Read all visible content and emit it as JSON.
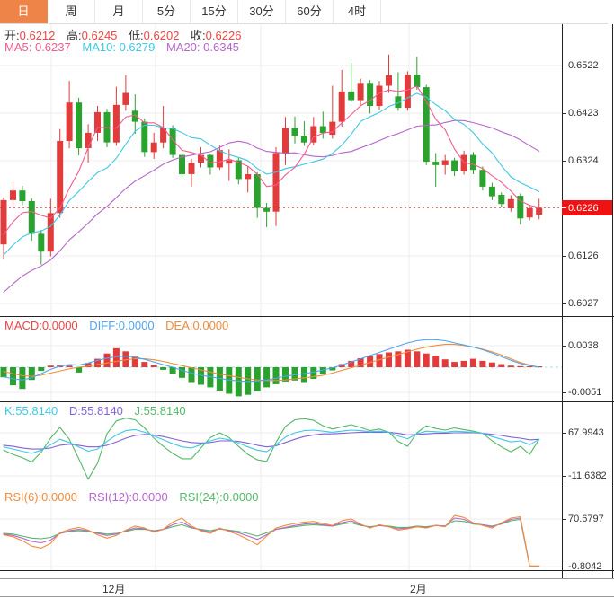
{
  "tabs": {
    "items": [
      {
        "label": "日",
        "active": true
      },
      {
        "label": "周",
        "active": false
      },
      {
        "label": "月",
        "active": false
      },
      {
        "label": "5分",
        "active": false
      },
      {
        "label": "15分",
        "active": false
      },
      {
        "label": "30分",
        "active": false
      },
      {
        "label": "60分",
        "active": false
      },
      {
        "label": "4时",
        "active": false
      }
    ]
  },
  "main_header": {
    "ohlc": [
      {
        "label": "开:",
        "value": "0.6212"
      },
      {
        "label": "高:",
        "value": "0.6245"
      },
      {
        "label": "低:",
        "value": "0.6202"
      },
      {
        "label": "收:",
        "value": "0.6226"
      }
    ],
    "ma": [
      {
        "label": "MA5:",
        "value": "0.6237"
      },
      {
        "label": "MA10:",
        "value": "0.6279"
      },
      {
        "label": "MA20:",
        "value": "0.6345"
      }
    ]
  },
  "macd_header": [
    {
      "label": "MACD:",
      "value": "0.0000"
    },
    {
      "label": "DIFF:",
      "value": "0.0000"
    },
    {
      "label": "DEA:",
      "value": "0.0000"
    }
  ],
  "kdj_header": [
    {
      "label": "K:",
      "value": "55.8140"
    },
    {
      "label": "D:",
      "value": "55.8140"
    },
    {
      "label": "J:",
      "value": "55.8140"
    }
  ],
  "rsi_header": [
    {
      "label": "RSI(6):",
      "value": "0.0000"
    },
    {
      "label": "RSI(12):",
      "value": "0.0000"
    },
    {
      "label": "RSI(24):",
      "value": "0.0000"
    }
  ],
  "axis": {
    "main": [
      "0.6522",
      "0.6423",
      "0.6324",
      "0.6126",
      "0.6027"
    ],
    "price_tag": "0.6226",
    "macd": [
      "0.0038",
      "-0.0051"
    ],
    "kdj": [
      "67.9943",
      "-11.6382"
    ],
    "rsi": [
      "70.6797",
      "-0.8042"
    ]
  },
  "xaxis": {
    "labels": [
      "12月",
      "2月"
    ]
  },
  "colors": {
    "up": "#e23b3b",
    "down": "#2aa22e",
    "ma5": "#f25c8c",
    "ma10": "#3fc7e3",
    "ma20": "#b764cd",
    "diff": "#4da6f0",
    "dea": "#f08c3c",
    "k": "#3fc7e3",
    "d": "#8461d8",
    "j": "#54b868",
    "rsi6": "#f08c3c",
    "rsi12": "#b764cd",
    "rsi24": "#54b868",
    "value_red": "#ef4444",
    "tab_active_bg": "#ef8449",
    "price_tag_bg": "#ee1212",
    "price_line": "#ef6a6a",
    "grid": "#ececec",
    "zero_line": "#a6dcef",
    "text": "#333333"
  },
  "chart_data": {
    "type": "candlestick",
    "panels": {
      "main": {
        "y_labels": [
          0.6522,
          0.6423,
          0.6324,
          0.6226,
          0.6126,
          0.6027
        ],
        "current_price": 0.6226
      },
      "macd": {
        "y_labels": [
          0.0038,
          -0.0051
        ]
      },
      "kdj": {
        "y_labels": [
          67.9943,
          -11.6382
        ]
      },
      "rsi": {
        "y_labels": [
          70.6797,
          -0.8042
        ]
      },
      "x_labels": [
        "12月",
        "2月"
      ]
    },
    "candles": [
      [
        0.615,
        0.6248,
        0.612,
        0.6242
      ],
      [
        0.6242,
        0.628,
        0.6225,
        0.6262
      ],
      [
        0.6262,
        0.6272,
        0.6232,
        0.624
      ],
      [
        0.624,
        0.6246,
        0.6158,
        0.6172
      ],
      [
        0.6172,
        0.618,
        0.6108,
        0.6135
      ],
      [
        0.6135,
        0.6245,
        0.6125,
        0.6215
      ],
      [
        0.6215,
        0.639,
        0.6205,
        0.6365
      ],
      [
        0.6365,
        0.649,
        0.635,
        0.6445
      ],
      [
        0.6445,
        0.6455,
        0.6335,
        0.635
      ],
      [
        0.635,
        0.64,
        0.632,
        0.6382
      ],
      [
        0.6382,
        0.6438,
        0.6365,
        0.6425
      ],
      [
        0.6425,
        0.6432,
        0.6352,
        0.6362
      ],
      [
        0.6362,
        0.6478,
        0.6355,
        0.644
      ],
      [
        0.644,
        0.6502,
        0.6428,
        0.6465
      ],
      [
        0.6428,
        0.6462,
        0.638,
        0.6405
      ],
      [
        0.6405,
        0.6412,
        0.6332,
        0.6342
      ],
      [
        0.6342,
        0.6382,
        0.6328,
        0.6362
      ],
      [
        0.6362,
        0.6438,
        0.635,
        0.6392
      ],
      [
        0.6392,
        0.6398,
        0.633,
        0.6336
      ],
      [
        0.6336,
        0.6342,
        0.6286,
        0.6296
      ],
      [
        0.6296,
        0.6328,
        0.627,
        0.632
      ],
      [
        0.632,
        0.6352,
        0.631,
        0.6336
      ],
      [
        0.6336,
        0.6338,
        0.6295,
        0.631
      ],
      [
        0.631,
        0.6356,
        0.6305,
        0.6346
      ],
      [
        0.6318,
        0.6348,
        0.6282,
        0.6325
      ],
      [
        0.6325,
        0.633,
        0.6275,
        0.6286
      ],
      [
        0.6286,
        0.6312,
        0.6258,
        0.6296
      ],
      [
        0.6296,
        0.63,
        0.6205,
        0.6226
      ],
      [
        0.6226,
        0.6236,
        0.6186,
        0.6218
      ],
      [
        0.6218,
        0.6352,
        0.6188,
        0.634
      ],
      [
        0.634,
        0.6415,
        0.6315,
        0.6392
      ],
      [
        0.6392,
        0.6416,
        0.636,
        0.6376
      ],
      [
        0.6376,
        0.6406,
        0.6355,
        0.6362
      ],
      [
        0.6362,
        0.6415,
        0.6356,
        0.6396
      ],
      [
        0.6396,
        0.6426,
        0.637,
        0.6382
      ],
      [
        0.6378,
        0.648,
        0.637,
        0.6405
      ],
      [
        0.6405,
        0.6513,
        0.6395,
        0.6468
      ],
      [
        0.6468,
        0.6528,
        0.6445,
        0.645
      ],
      [
        0.645,
        0.6495,
        0.644,
        0.6486
      ],
      [
        0.6486,
        0.6492,
        0.6422,
        0.6438
      ],
      [
        0.6438,
        0.649,
        0.643,
        0.648
      ],
      [
        0.648,
        0.6545,
        0.6465,
        0.6502
      ],
      [
        0.6458,
        0.6508,
        0.6428,
        0.6434
      ],
      [
        0.6434,
        0.651,
        0.6428,
        0.6503
      ],
      [
        0.6503,
        0.654,
        0.6472,
        0.6477
      ],
      [
        0.6477,
        0.6482,
        0.6315,
        0.6322
      ],
      [
        0.6322,
        0.634,
        0.627,
        0.6315
      ],
      [
        0.6315,
        0.6336,
        0.6295,
        0.6325
      ],
      [
        0.6325,
        0.633,
        0.6292,
        0.6302
      ],
      [
        0.6302,
        0.6345,
        0.6295,
        0.6336
      ],
      [
        0.6336,
        0.6342,
        0.6296,
        0.6305
      ],
      [
        0.6305,
        0.6312,
        0.6262,
        0.627
      ],
      [
        0.627,
        0.6278,
        0.6242,
        0.625
      ],
      [
        0.6253,
        0.6258,
        0.6228,
        0.6234
      ],
      [
        0.6225,
        0.6252,
        0.6218,
        0.6244
      ],
      [
        0.6251,
        0.6256,
        0.6191,
        0.6204
      ],
      [
        0.6206,
        0.6232,
        0.62,
        0.6225
      ],
      [
        0.6212,
        0.6245,
        0.6202,
        0.6226
      ]
    ],
    "ma_seed": [
      0.59,
      0.591,
      0.592,
      0.5935,
      0.595,
      0.5965,
      0.598,
      0.5995,
      0.601,
      0.6025,
      0.604,
      0.6055,
      0.607,
      0.6085,
      0.61,
      0.6115,
      0.613,
      0.6145,
      0.616,
      0.6175
    ],
    "macd": {
      "scale": 0.0001,
      "hist": [
        -19,
        -34,
        -41,
        -24,
        -7,
        3,
        4,
        3,
        -10,
        8,
        16,
        26,
        36,
        30,
        20,
        10,
        4,
        -5,
        -12,
        -20,
        -28,
        -33,
        -38,
        -44,
        -50,
        -55,
        -52,
        -45,
        -38,
        -32,
        -27,
        -25,
        -28,
        -22,
        -13,
        -6,
        6,
        12,
        17,
        21,
        25,
        28,
        30,
        33,
        30,
        26,
        22,
        15,
        10,
        12,
        16,
        12,
        9,
        6,
        3,
        2,
        1,
        0
      ],
      "diff": [
        -18,
        -22,
        -24,
        -20,
        -12,
        -4,
        2,
        5,
        4,
        8,
        13,
        17,
        20,
        21,
        19,
        15,
        10,
        5,
        0,
        -6,
        -11,
        -15,
        -18,
        -21,
        -24,
        -26,
        -27,
        -26,
        -24,
        -21,
        -17,
        -14,
        -12,
        -9,
        -5,
        -1,
        4,
        10,
        16,
        22,
        28,
        34,
        40,
        46,
        50,
        52,
        52,
        50,
        46,
        42,
        38,
        33,
        27,
        20,
        13,
        7,
        3,
        0
      ],
      "dea": [
        -8,
        -12,
        -16,
        -17,
        -15,
        -11,
        -7,
        -3,
        0,
        2,
        5,
        8,
        11,
        14,
        16,
        16,
        14,
        11,
        7,
        3,
        -1,
        -5,
        -9,
        -13,
        -16,
        -19,
        -22,
        -24,
        -25,
        -25,
        -24,
        -22,
        -20,
        -18,
        -15,
        -11,
        -6,
        -1,
        4,
        9,
        14,
        19,
        24,
        29,
        34,
        38,
        41,
        43,
        43,
        41,
        38,
        34,
        29,
        23,
        16,
        9,
        4,
        0
      ]
    },
    "kdj": {
      "k": [
        42,
        38,
        34,
        30,
        36,
        46,
        56,
        50,
        42,
        34,
        38,
        52,
        64,
        72,
        74,
        69,
        62,
        55,
        48,
        42,
        40,
        46,
        53,
        58,
        55,
        49,
        42,
        36,
        33,
        46,
        60,
        68,
        72,
        73,
        71,
        69,
        71,
        73,
        72,
        70,
        71,
        69,
        62,
        57,
        66,
        71,
        70,
        69,
        71,
        70,
        69,
        67,
        61,
        56,
        51,
        53,
        46,
        55.81
      ],
      "d": [
        45,
        43,
        40,
        38,
        38,
        40,
        45,
        47,
        45,
        42,
        42,
        45,
        51,
        58,
        63,
        65,
        64,
        61,
        57,
        53,
        50,
        49,
        50,
        53,
        53,
        52,
        49,
        45,
        42,
        44,
        50,
        56,
        61,
        64,
        66,
        66,
        67,
        68,
        69,
        69,
        69,
        69,
        67,
        64,
        65,
        66,
        67,
        67,
        68,
        68,
        68,
        67,
        65,
        63,
        60,
        58,
        55,
        55.81
      ],
      "j": [
        36,
        28,
        22,
        14,
        32,
        58,
        78,
        56,
        20,
        -18,
        12,
        66,
        90,
        95,
        92,
        77,
        58,
        43,
        30,
        20,
        20,
        40,
        59,
        68,
        59,
        43,
        28,
        18,
        15,
        50,
        80,
        92,
        94,
        91,
        81,
        75,
        79,
        83,
        78,
        72,
        75,
        69,
        52,
        43,
        68,
        81,
        76,
        73,
        77,
        74,
        71,
        67,
        53,
        42,
        33,
        43,
        28,
        55.81
      ]
    },
    "rsi": {
      "rsi6": [
        47,
        44,
        38,
        30,
        27,
        34,
        50,
        55,
        58,
        54,
        47,
        42,
        46,
        54,
        60,
        57,
        51,
        55,
        66,
        72,
        60,
        53,
        49,
        57,
        52,
        47,
        40,
        32,
        45,
        57,
        61,
        64,
        66,
        67,
        64,
        61,
        68,
        71,
        63,
        57,
        62,
        59,
        54,
        56,
        59,
        57,
        61,
        59,
        76,
        73,
        65,
        61,
        57,
        65,
        72,
        74,
        0,
        0
      ],
      "rsi12": [
        48,
        46,
        42,
        37,
        35,
        39,
        49,
        53,
        55,
        53,
        49,
        46,
        48,
        53,
        57,
        56,
        52,
        55,
        62,
        66,
        58,
        54,
        51,
        56,
        53,
        50,
        45,
        40,
        47,
        55,
        58,
        61,
        63,
        64,
        62,
        60,
        65,
        68,
        62,
        58,
        61,
        59,
        56,
        57,
        59,
        58,
        61,
        60,
        72,
        70,
        64,
        62,
        59,
        64,
        70,
        72,
        0,
        0
      ],
      "rsi24": [
        49,
        48,
        45,
        42,
        41,
        43,
        49,
        52,
        53,
        52,
        50,
        48,
        49,
        52,
        55,
        55,
        53,
        55,
        59,
        62,
        57,
        55,
        53,
        56,
        54,
        52,
        49,
        45,
        50,
        55,
        57,
        59,
        61,
        62,
        61,
        60,
        63,
        65,
        61,
        59,
        61,
        60,
        58,
        58,
        60,
        59,
        61,
        60,
        68,
        67,
        63,
        62,
        60,
        63,
        68,
        70,
        0,
        0
      ]
    }
  }
}
